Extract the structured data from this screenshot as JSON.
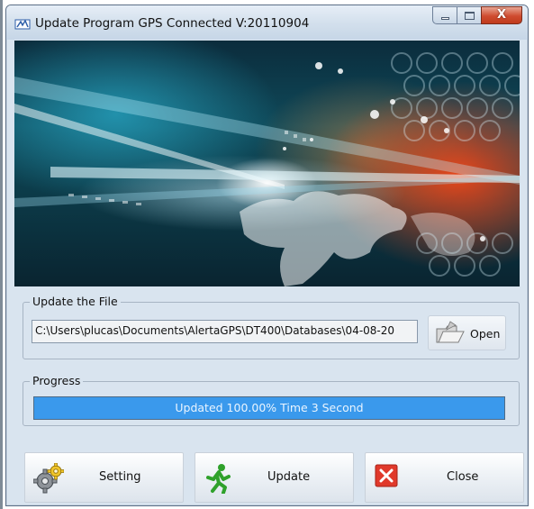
{
  "window": {
    "title": "Update Program   GPS Connected   V:20110904",
    "icon": "app-update-icon"
  },
  "caption_buttons": {
    "minimize_icon": "minimize-icon",
    "maximize_icon": "maximize-icon",
    "close_icon": "close-x-icon",
    "close_glyph": "X"
  },
  "file_group": {
    "label": "Update the File",
    "path_value": "C:\\Users\\plucas\\Documents\\AlertaGPS\\DT400\\Databases\\04-08-20",
    "open_label": "Open",
    "open_icon": "open-folder-icon"
  },
  "progress_group": {
    "label": "Progress",
    "percent": 100,
    "text": "Updated 100.00%   Time 3 Second",
    "fill_color": "#3a99ec"
  },
  "actions": {
    "setting_label": "Setting",
    "setting_icon": "gears-icon",
    "update_label": "Update",
    "update_icon": "running-man-icon",
    "close_label": "Close",
    "close_icon": "red-x-icon"
  },
  "colors": {
    "window_bg": "#d9e4ef",
    "close_red": "#cf4b2f",
    "accent_blue": "#3a99ec"
  }
}
